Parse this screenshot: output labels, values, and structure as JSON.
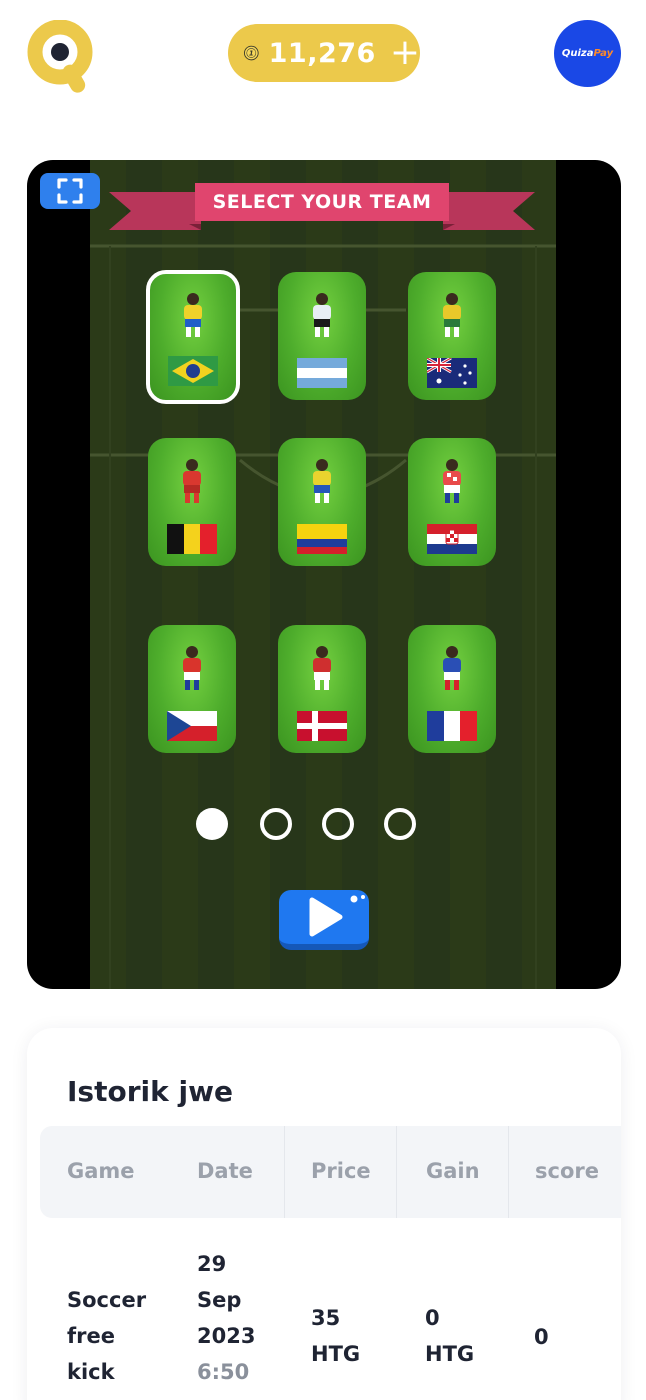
{
  "header": {
    "coin_balance": "11,276",
    "coin_symbol": "1",
    "plus_label": "+",
    "brand_q": "Quiza",
    "brand_p": "Pay"
  },
  "game": {
    "title": "SELECT YOUR TEAM",
    "teams": [
      {
        "country": "brazil",
        "selected": true,
        "shirt": "#f0d22a",
        "shorts": "#1f5fc8"
      },
      {
        "country": "argentina",
        "selected": false,
        "shirt": "#e8eef5",
        "shorts": "#1a1a1a"
      },
      {
        "country": "australia",
        "selected": false,
        "shirt": "#e9c82a",
        "shorts": "#2a7a3a"
      },
      {
        "country": "belgium",
        "selected": false,
        "shirt": "#d9382f",
        "shorts": "#b52a24"
      },
      {
        "country": "colombia",
        "selected": false,
        "shirt": "#e9d32e",
        "shorts": "#2556b8"
      },
      {
        "country": "croatia",
        "selected": false,
        "shirt": "#e84a4a",
        "shorts": "#ffffff"
      },
      {
        "country": "czech",
        "selected": false,
        "shirt": "#d9342c",
        "shorts": "#ffffff"
      },
      {
        "country": "denmark",
        "selected": false,
        "shirt": "#cf2f2f",
        "shorts": "#ffffff"
      },
      {
        "country": "france",
        "selected": false,
        "shirt": "#2a4fb5",
        "shorts": "#ffffff"
      }
    ],
    "pages": 4,
    "active_page": 0
  },
  "history": {
    "title": "Istorik jwe",
    "columns": [
      "Game",
      "Date",
      "Price",
      "Gain",
      "score"
    ],
    "rows": [
      {
        "game": [
          "Soccer",
          "free",
          "kick"
        ],
        "date": [
          "29",
          "Sep",
          "2023",
          "6:50"
        ],
        "price": [
          "35",
          "HTG"
        ],
        "gain": [
          "0",
          "HTG"
        ],
        "score": "0"
      }
    ]
  },
  "colors": {
    "accent_yellow": "#ecc94b",
    "brand_blue": "#1a48e6",
    "ribbon_pink": "#e0456e",
    "button_blue": "#1f78f0"
  },
  "icons": {
    "logo": "quiz-logo-icon",
    "coin": "coin-icon",
    "fullscreen": "fullscreen-icon",
    "play": "play-icon"
  }
}
